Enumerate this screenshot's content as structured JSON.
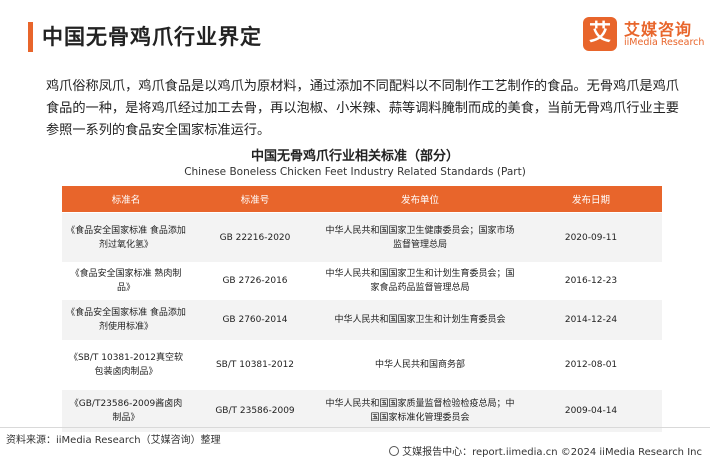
{
  "header": {
    "title": "中国无骨鸡爪行业界定"
  },
  "logo": {
    "mark": "艾",
    "name_cn": "艾媒咨询",
    "name_en": "iiMedia Research"
  },
  "intro": "鸡爪俗称凤爪，鸡爪食品是以鸡爪为原材料，通过添加不同配料以不同制作工艺制作的食品。无骨鸡爪是鸡爪食品的一种，是将鸡爪经过加工去骨，再以泡椒、小米辣、蒜等调料腌制而成的美食，当前无骨鸡爪行业主要参照一系列的食品安全国家标准运行。",
  "table": {
    "title_cn": "中国无骨鸡爪行业相关标准（部分）",
    "title_en": "Chinese Boneless Chicken Feet Industry Related Standards (Part)",
    "headers": [
      "标准名",
      "标准号",
      "发布单位",
      "发布日期"
    ],
    "rows": [
      [
        "《食品安全国家标准 食品添加剂过氧化氢》",
        "GB 22216-2020",
        "中华人民共和国国家卫生健康委员会；国家市场监督管理总局",
        "2020-09-11"
      ],
      [
        "《食品安全国家标准 熟肉制品》",
        "GB 2726-2016",
        "中华人民共和国国家卫生和计划生育委员会；国家食品药品监督管理总局",
        "2016-12-23"
      ],
      [
        "《食品安全国家标准 食品添加剂使用标准》",
        "GB 2760-2014",
        "中华人民共和国国家卫生和计划生育委员会",
        "2014-12-24"
      ],
      [
        "《SB/T 10381-2012真空软包装卤肉制品》",
        "SB/T 10381-2012",
        "中华人民共和国商务部",
        "2012-08-01"
      ],
      [
        "《GB/T23586-2009酱卤肉制品》",
        "GB/T 23586-2009",
        "中华人民共和国国家质量监督检验检疫总局；中国国家标准化管理委员会",
        "2009-04-14"
      ]
    ]
  },
  "footer": {
    "source": "资料来源：iiMedia Research（艾媒咨询）整理",
    "right": "艾媒报告中心：report.iimedia.cn  ©2024  iiMedia Research  Inc"
  },
  "colors": {
    "accent": "#e8652b",
    "row_alt": "#f3f3f3"
  }
}
